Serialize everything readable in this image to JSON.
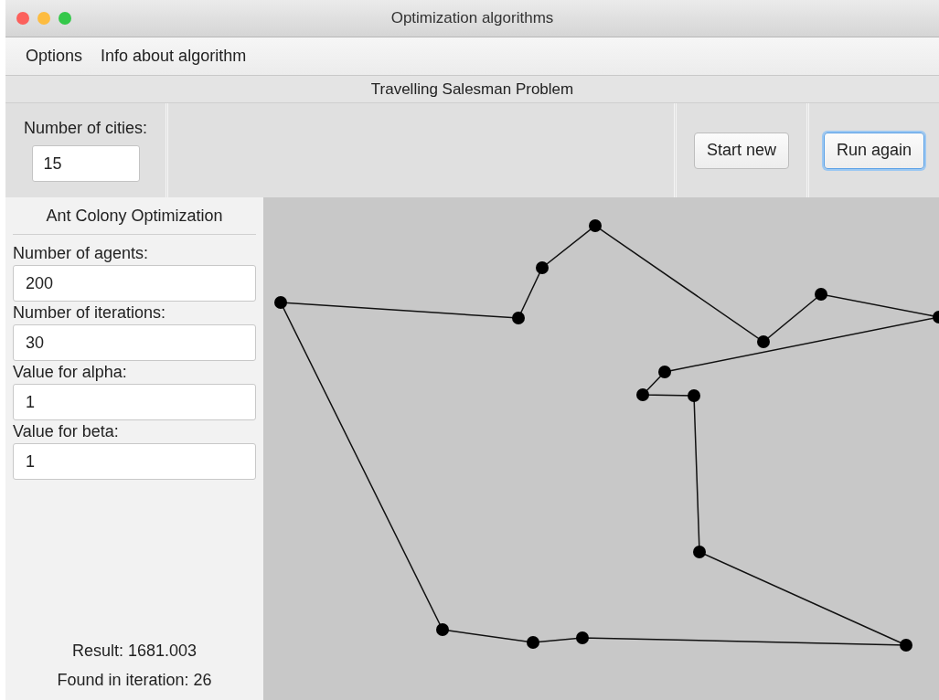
{
  "window": {
    "title": "Optimization algorithms"
  },
  "menu": [
    {
      "label": "Options"
    },
    {
      "label": "Info about algorithm"
    }
  ],
  "problem_title": "Travelling Salesman Problem",
  "toolbar": {
    "cities": {
      "label": "Number of cities:",
      "value": "15"
    },
    "buttons": [
      {
        "label": "Start new",
        "focused": false
      },
      {
        "label": "Run again",
        "focused": true
      }
    ]
  },
  "algorithm_panel": {
    "title": "Ant Colony Optimization",
    "fields": [
      {
        "label": "Number of agents:",
        "value": "200"
      },
      {
        "label": "Number of iterations:",
        "value": "30"
      },
      {
        "label": "Value for alpha:",
        "value": "1"
      },
      {
        "label": "Value for beta:",
        "value": "1"
      }
    ],
    "result": "Result: 1681.003",
    "found": "Found in iteration: 26"
  }
}
